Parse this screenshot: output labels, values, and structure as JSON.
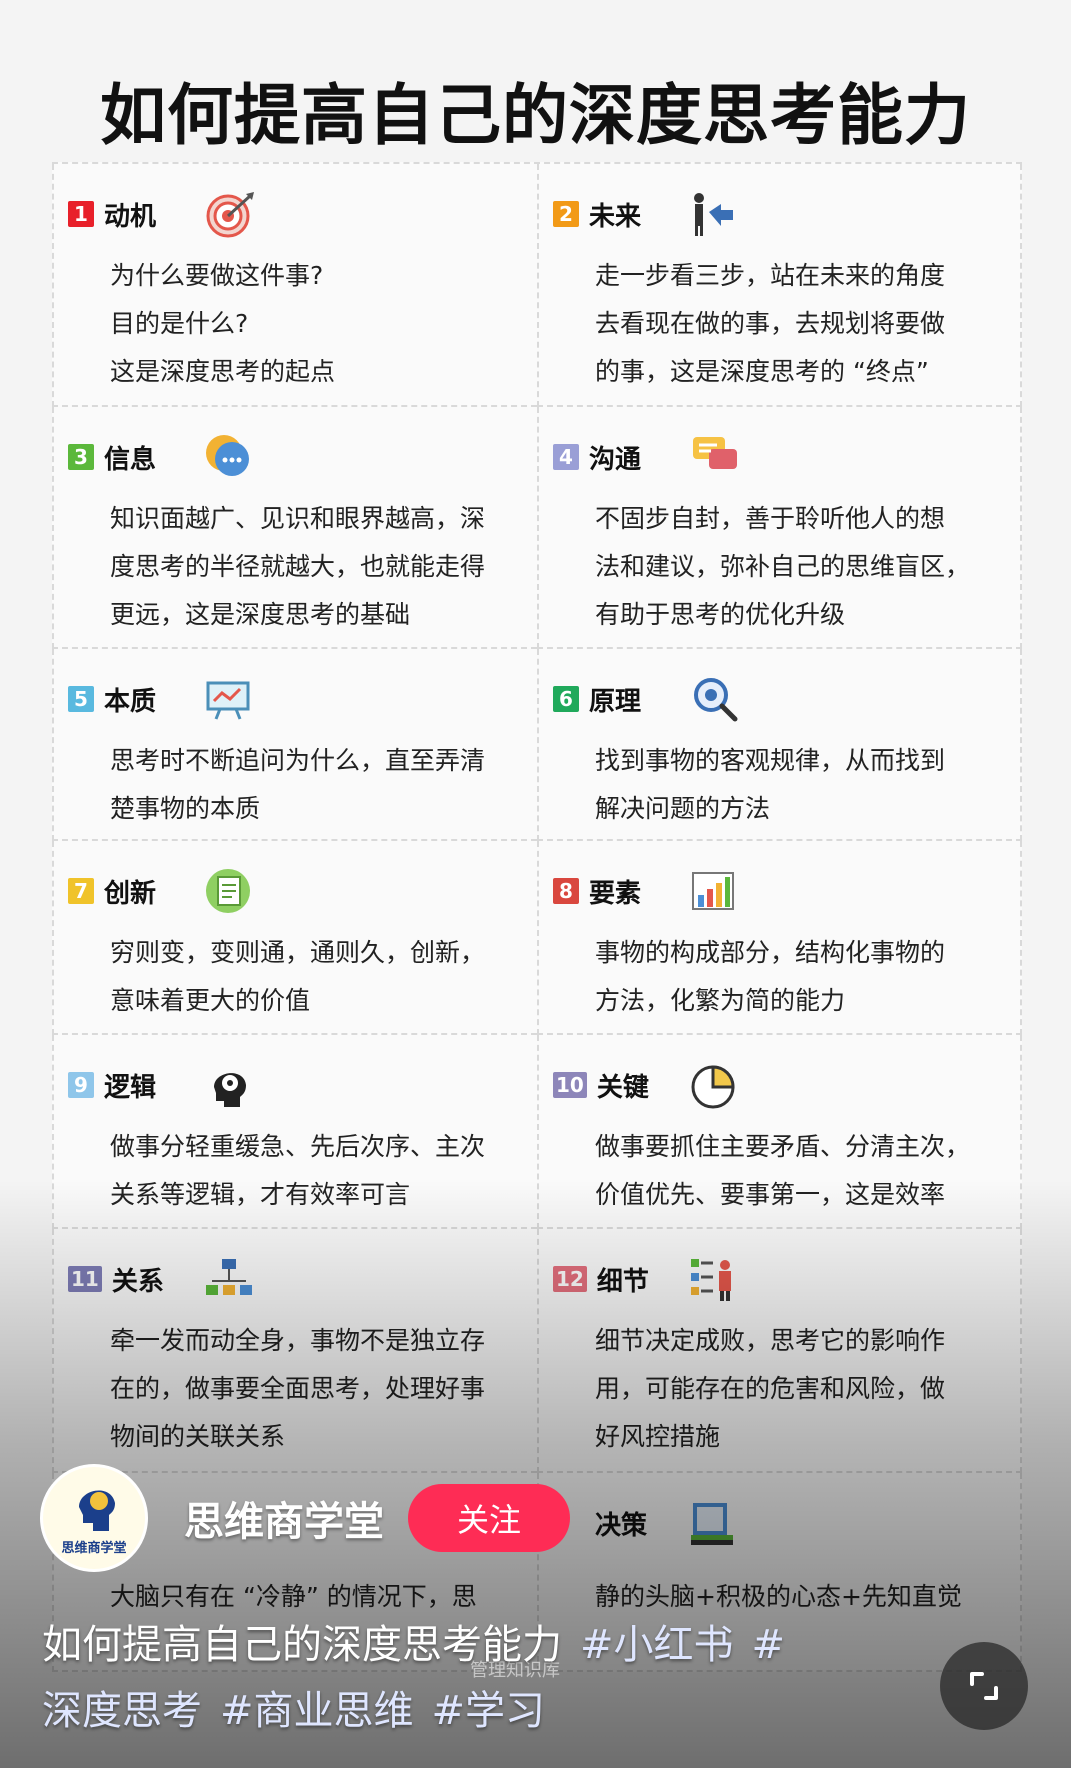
{
  "page_title": "如何提高自己的深度思考能力",
  "cards": [
    {
      "num": "1",
      "title": "动机",
      "icon": "target-icon",
      "lines": [
        "为什么要做这件事?",
        "目的是什么?",
        "这是深度思考的起点"
      ]
    },
    {
      "num": "2",
      "title": "未来",
      "icon": "strategy-icon",
      "lines": [
        "走一步看三步，站在未来的角度",
        "去看现在做的事，去规划将要做",
        "的事，这是深度思考的 “终点”"
      ]
    },
    {
      "num": "3",
      "title": "信息",
      "icon": "chat-bubble-icon",
      "lines": [
        "知识面越广、见识和眼界越高，深",
        "度思考的半径就越大，也就能走得",
        "更远，这是深度思考的基础"
      ]
    },
    {
      "num": "4",
      "title": "沟通",
      "icon": "conversation-icon",
      "lines": [
        "不固步自封，善于聆听他人的想",
        "法和建议，弥补自己的思维盲区，",
        "有助于思考的优化升级"
      ]
    },
    {
      "num": "5",
      "title": "本质",
      "icon": "whiteboard-icon",
      "lines": [
        "思考时不断追问为什么，直至弄清",
        "楚事物的本质"
      ]
    },
    {
      "num": "6",
      "title": "原理",
      "icon": "magnifier-icon",
      "lines": [
        "找到事物的客观规律，从而找到",
        "解决问题的方法"
      ]
    },
    {
      "num": "7",
      "title": "创新",
      "icon": "document-icon",
      "lines": [
        "穷则变，变则通，通则久，创新，",
        "意味着更大的价值"
      ]
    },
    {
      "num": "8",
      "title": "要素",
      "icon": "bar-chart-icon",
      "lines": [
        "事物的构成部分，结构化事物的",
        "方法，化繁为简的能力"
      ]
    },
    {
      "num": "9",
      "title": "逻辑",
      "icon": "head-gear-icon",
      "lines": [
        "做事分轻重缓急、先后次序、主次",
        "关系等逻辑，才有效率可言"
      ]
    },
    {
      "num": "10",
      "title": "关键",
      "icon": "pie-chart-icon",
      "lines": [
        "做事要抓住主要矛盾、分清主次，",
        "价值优先、要事第一，这是效率"
      ]
    },
    {
      "num": "11",
      "title": "关系",
      "icon": "org-chart-icon",
      "lines": [
        "牵一发而动全身，事物不是独立存",
        "在的，做事要全面思考，处理好事",
        "物间的关联关系"
      ]
    },
    {
      "num": "12",
      "title": "细节",
      "icon": "checklist-icon",
      "lines": [
        "细节决定成败，思考它的影响作",
        "用，可能存在的危害和风险，做",
        "好风控措施"
      ]
    },
    {
      "num": "",
      "title": "",
      "icon": "",
      "lines": [
        "大脑只有在 “冷静” 的情况下，思"
      ]
    },
    {
      "num": "",
      "title": "决策",
      "icon": "books-icon",
      "lines": [
        "静的头脑+积极的心态+先知直觉"
      ]
    }
  ],
  "author": {
    "name": "思维商学堂",
    "avatar_text": "思维商学堂",
    "follow_label": "关注"
  },
  "caption": {
    "text": "如何提高自己的深度思考能力",
    "tags": [
      "#小红书",
      "#",
      "深度思考",
      "#商业思维",
      "#学习"
    ]
  },
  "watermark": "管理知识库",
  "colors": {
    "follow": "#fe2c55",
    "tag": "#dfe6ff"
  }
}
